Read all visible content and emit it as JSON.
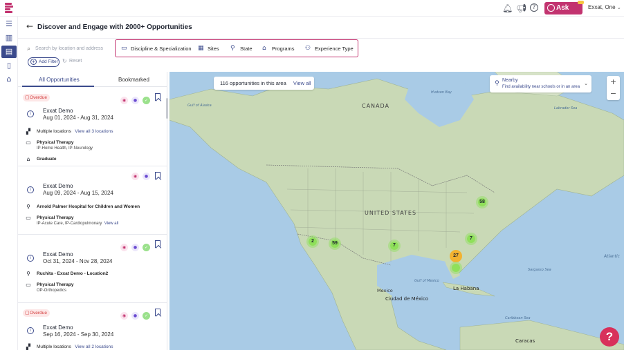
{
  "topbar": {
    "ask_leo": "Ask Leo",
    "user_name": "Exxat, One",
    "icons": [
      "bell-icon",
      "megaphone-icon",
      "help-circle-icon"
    ]
  },
  "rail": {
    "icons": [
      "menu-icon",
      "analytics-icon",
      "document-icon",
      "file-icon",
      "graduation-icon"
    ]
  },
  "header": {
    "title": "Discover and Engage with 2000+ Opportunities"
  },
  "search": {
    "placeholder": "Search by location and address"
  },
  "filters": [
    {
      "label": "Discipline & Specialization",
      "icon": "book-icon"
    },
    {
      "label": "Sites",
      "icon": "building-icon"
    },
    {
      "label": "State",
      "icon": "location-pin-icon"
    },
    {
      "label": "Programs",
      "icon": "graduation-icon"
    },
    {
      "label": "Experience Type",
      "icon": "people-icon"
    }
  ],
  "add_filter": "Add Filter",
  "reset": "Reset",
  "tabs": {
    "all": "All Opportunities",
    "bookmarked": "Bookmarked"
  },
  "cards": [
    {
      "overdue": "Overdue",
      "org": "Exxat Demo",
      "dates": "Aug 01, 2024 - Aug 31, 2024",
      "location": "Multiple locations",
      "location_link": "View all 3 locations",
      "discipline": "Physical Therapy",
      "specialization": "IP-Home Health, IP-Neurology",
      "level": "Graduate"
    },
    {
      "org": "Exxat Demo",
      "dates": "Aug 09, 2024 - Aug 15, 2024",
      "location": "Arnold Palmer Hospital for Children and Women",
      "discipline": "Physical Therapy",
      "specialization": "IP-Acute Care, IP-Cardiopulmonary",
      "spec_link": "View all"
    },
    {
      "org": "Exxat Demo",
      "dates": "Oct 31, 2024 - Nov 28, 2024",
      "location": "Ruchita - Exxat Demo - Location2",
      "discipline": "Physical Therapy",
      "specialization": "OP-Orthopedics"
    },
    {
      "overdue": "Overdue",
      "org": "Exxat Demo",
      "dates": "Sep 16, 2024 - Sep 30, 2024",
      "location": "Multiple locations",
      "location_link": "View all 2 locations"
    }
  ],
  "map": {
    "banner": "116 opportunities in this area",
    "view_all": "View all",
    "nearby_title": "Nearby",
    "nearby_sub": "Find availability near schools or in an area",
    "zoom_in": "+",
    "zoom_out": "−",
    "clusters": [
      "2",
      "59",
      "7",
      "27",
      "7",
      "58"
    ],
    "labels": {
      "canada": "CANADA",
      "us": "UNITED STATES",
      "mexico": "Mexico",
      "cdmx": "Ciudad de México",
      "habana": "La Habana",
      "caracas": "Caracas",
      "hudson": "Hudson Bay",
      "alaska": "Gulf of Alaska",
      "labrador": "Labrador Sea",
      "gulf": "Gulf of Mexico",
      "atlantic": "Atlantic",
      "sargasso": "Sargasso Sea",
      "caribbean": "Caribbean Sea"
    }
  }
}
